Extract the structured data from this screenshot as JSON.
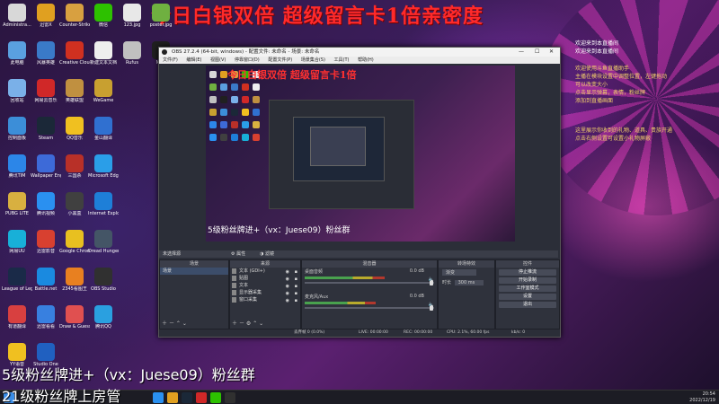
{
  "banner_top": "今日白银双倍 超级留言卡1倍亲密度",
  "bottom_overlay": {
    "line1": "5级粉丝牌进+（vx：Juese09）粉丝群",
    "line2": "21级粉丝牌上房管"
  },
  "desktop_icons": [
    {
      "label": "Administra...",
      "color": "#d8d8d8"
    },
    {
      "label": "迅雷X",
      "color": "#e0a020"
    },
    {
      "label": "Counter-Strike...",
      "color": "#d8a040"
    },
    {
      "label": "微信",
      "color": "#2dc100"
    },
    {
      "label": "123.jpg",
      "color": "#e8e8e8"
    },
    {
      "label": "poster.jpg",
      "color": "#6fb040"
    },
    {
      "label": "此电脑",
      "color": "#5aa0e0"
    },
    {
      "label": "风暴英雄",
      "color": "#3a7ac8"
    },
    {
      "label": "Creative Cloud",
      "color": "#d03020"
    },
    {
      "label": "新建文本文档",
      "color": "#eeeeee"
    },
    {
      "label": "Rufus",
      "color": "#c0c0c0"
    },
    {
      "label": "MAP",
      "color": "#202020"
    },
    {
      "label": "回收站",
      "color": "#7ab0e8"
    },
    {
      "label": "网易云音乐",
      "color": "#d02828"
    },
    {
      "label": "英雄联盟",
      "color": "#c09040"
    },
    {
      "label": "WeGame",
      "color": "#c8a030"
    },
    {
      "label": "控制面板",
      "color": "#3c8ed8"
    },
    {
      "label": "Steam",
      "color": "#1b2838"
    },
    {
      "label": "QQ音乐",
      "color": "#f0c020"
    },
    {
      "label": "金山翻译",
      "color": "#3070d0"
    },
    {
      "label": "腾讯TIM",
      "color": "#2c86e8"
    },
    {
      "label": "Wallpaper Engine",
      "color": "#3d6ad8"
    },
    {
      "label": "三国杀",
      "color": "#b83028"
    },
    {
      "label": "Microsoft Edge",
      "color": "#2a9ee8"
    },
    {
      "label": "PUBG LITE",
      "color": "#d8b040"
    },
    {
      "label": "腾讯视频",
      "color": "#2a90f0"
    },
    {
      "label": "小黑盒",
      "color": "#404040"
    },
    {
      "label": "Internet Explorer",
      "color": "#1e7fd8"
    },
    {
      "label": "网易UU",
      "color": "#18b0d8"
    },
    {
      "label": "迅雷影音",
      "color": "#d84030"
    },
    {
      "label": "Google Chrome",
      "color": "#e8c020"
    },
    {
      "label": "Dread Hunger",
      "color": "#445566"
    },
    {
      "label": "League of Legends",
      "color": "#1a2a48"
    },
    {
      "label": "Battle.net",
      "color": "#1a8ae0"
    },
    {
      "label": "2345看图王",
      "color": "#e88020"
    },
    {
      "label": "OBS Studio",
      "color": "#303030"
    },
    {
      "label": "有道翻译",
      "color": "#d84040"
    },
    {
      "label": "迅雷看看",
      "color": "#3880e0"
    },
    {
      "label": "Draw & Guess",
      "color": "#e05050"
    },
    {
      "label": "腾讯QQ",
      "color": "#2aa0e0"
    },
    {
      "label": "YY语音",
      "color": "#f0c020"
    },
    {
      "label": "Studio One",
      "color": "#2060c0"
    }
  ],
  "chat": [
    {
      "text": "欢迎来到本直播间",
      "style": "w"
    },
    {
      "text": "欢迎来到本直播间",
      "style": "w"
    },
    {
      "text": "欢迎使用斗鱼直播助手",
      "style": "y"
    },
    {
      "text": "主播在模块设置中调整位置，左键拖动",
      "style": "y"
    },
    {
      "text": "可以改变大小",
      "style": "y"
    },
    {
      "text": "点击显示弹幕，表情，粉丝牌",
      "style": "y"
    },
    {
      "text": "添加到直播画面",
      "style": "y"
    },
    {
      "text": "这里展示你收到的礼物、道具、贵族开通",
      "style": "y"
    },
    {
      "text": "点击右侧设置可设置小礼物屏蔽",
      "style": "y"
    }
  ],
  "obs": {
    "title": "OBS 27.2.4 (64-bit, windows) - 配置文件: 未命名 - 场景: 未命名",
    "menu": [
      "文件(F)",
      "编辑(E)",
      "视图(V)",
      "停靠窗口(D)",
      "配置文件(P)",
      "场景集合(S)",
      "工具(T)",
      "帮助(H)"
    ],
    "preview_banner": "今日白银双倍 超级留言卡1倍",
    "preview_text": "5级粉丝牌进+（vx：Juese09）粉丝群",
    "source_bar": {
      "label": "未选择源",
      "props": "属性",
      "filters": "滤镜"
    },
    "panels": {
      "scenes": {
        "header": "场景",
        "items": [
          "场景"
        ]
      },
      "sources": {
        "header": "来源",
        "items": [
          "文本 (GDI+)",
          "贴图",
          "文本",
          "显示器采集",
          "窗口采集"
        ]
      },
      "mixer": {
        "header": "混音器",
        "channels": [
          {
            "name": "桌面音频",
            "db": "0.0 dB",
            "level": 0.62
          },
          {
            "name": "麦克风/Aux",
            "db": "0.0 dB",
            "level": 0.55
          }
        ]
      },
      "transitions": {
        "header": "转场特效",
        "type": "渐变",
        "duration_label": "时长",
        "duration": "300 ms"
      },
      "controls": {
        "header": "控件",
        "buttons": [
          "停止推流",
          "开始录制",
          "工作室模式",
          "设置",
          "退出"
        ]
      }
    },
    "status": {
      "dropped": "丢弃帧 0 (0.0%)",
      "live": "LIVE: 00:00:00",
      "rec": "REC: 00:00:00",
      "cpu": "CPU: 2.1%, 60.00 fps",
      "kbps": "kb/s: 0"
    }
  },
  "taskbar": {
    "time": "20:54",
    "date": "2022/12/19",
    "apps": [
      "#2a90f0",
      "#e0a020",
      "#1b2838",
      "#d02828",
      "#2dc100",
      "#303030"
    ]
  }
}
